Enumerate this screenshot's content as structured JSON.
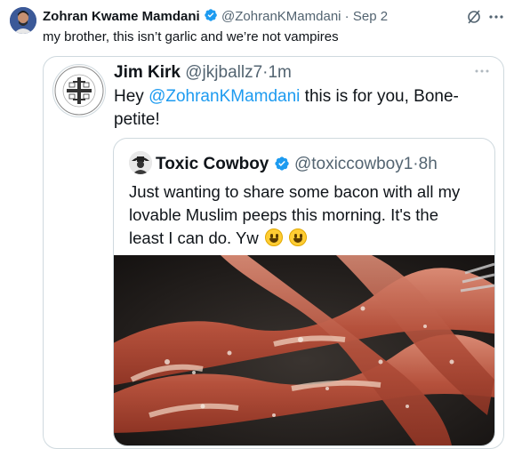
{
  "tweet": {
    "author_name": "Zohran Kwame Mamdani",
    "handle": "@ZohranKMamdani",
    "separator": "·",
    "date": "Sep 2",
    "text": "my brother, this isn’t garlic and we’re not vampires",
    "icons": [
      "grok-icon",
      "more-icon"
    ]
  },
  "quote": {
    "author_name": "Jim Kirk",
    "handle": "@jkjballz7",
    "separator": "·",
    "time": "1m",
    "text_prefix": "Hey ",
    "mention": "@ZohranKMamdani",
    "text_suffix_line1": " this is for you, Bone-",
    "text_line2": "petite!",
    "more_icon": "more-icon"
  },
  "nested_quote": {
    "author_name": "Toxic Cowboy",
    "handle": "@toxiccowboy1",
    "separator": "·",
    "time": "8h",
    "text_line1": "Just wanting to share some bacon with all my",
    "text_line2": "lovable Muslim peeps this morning. It's the",
    "text_line3": "least I can do. Yw",
    "emoji": "grinning-face-icon"
  },
  "colors": {
    "accent": "#1d9bf0",
    "verified": "#1d9bf0",
    "secondary_text": "#536471",
    "border": "#cfd9de"
  }
}
